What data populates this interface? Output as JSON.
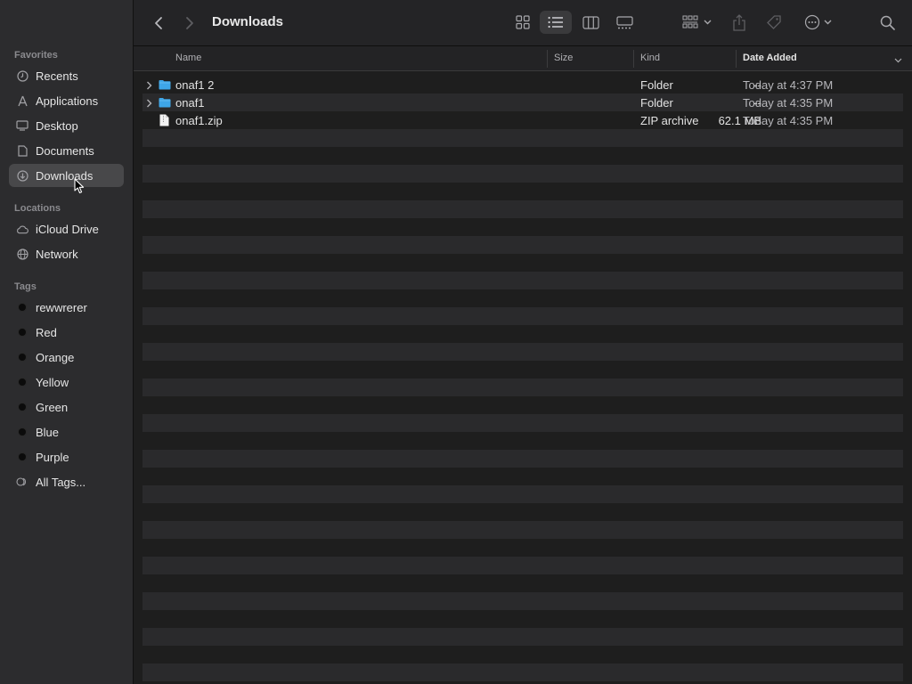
{
  "sidebar": {
    "favorites_label": "Favorites",
    "favorites": [
      {
        "label": "Recents",
        "icon": "clock-icon"
      },
      {
        "label": "Applications",
        "icon": "applications-icon"
      },
      {
        "label": "Desktop",
        "icon": "desktop-icon"
      },
      {
        "label": "Documents",
        "icon": "document-icon"
      },
      {
        "label": "Downloads",
        "icon": "download-icon",
        "selected": true
      }
    ],
    "locations_label": "Locations",
    "locations": [
      {
        "label": "iCloud Drive",
        "icon": "cloud-icon"
      },
      {
        "label": "Network",
        "icon": "globe-icon"
      }
    ],
    "tags_label": "Tags",
    "tags": [
      {
        "label": "rewwrerer"
      },
      {
        "label": "Red"
      },
      {
        "label": "Orange"
      },
      {
        "label": "Yellow"
      },
      {
        "label": "Green"
      },
      {
        "label": "Blue"
      },
      {
        "label": "Purple"
      },
      {
        "label": "All Tags...",
        "icon": "all-tags-icon"
      }
    ]
  },
  "toolbar": {
    "title": "Downloads",
    "view_mode": "list"
  },
  "columns": {
    "name": "Name",
    "size": "Size",
    "kind": "Kind",
    "date_added": "Date Added",
    "sorted_by": "date_added"
  },
  "files": [
    {
      "name": "onaf1 2",
      "size": "--",
      "kind": "Folder",
      "date_added": "Today at 4:37 PM",
      "type": "folder"
    },
    {
      "name": "onaf1",
      "size": "--",
      "kind": "Folder",
      "date_added": "Today at 4:35 PM",
      "type": "folder"
    },
    {
      "name": "onaf1.zip",
      "size": "62.1 MB",
      "kind": "ZIP archive",
      "date_added": "Today at 4:35 PM",
      "type": "zip"
    }
  ],
  "colors": {
    "sidebar_bg": "#2c2c2e",
    "selected_bg": "#48484a",
    "folder_blue": "#3ea6e8",
    "window_bg": "#1e1e1e"
  }
}
